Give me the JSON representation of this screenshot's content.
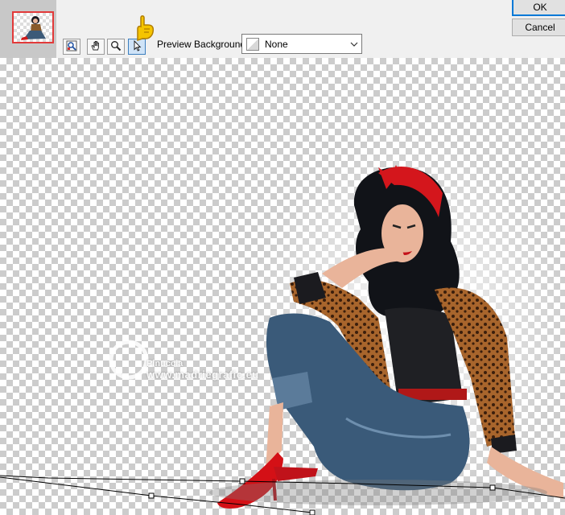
{
  "toolbar": {
    "preview_background_label": "Preview Background:",
    "preview_background_value": "None",
    "tools": [
      "zoom-fit-icon",
      "hand-icon",
      "magnifier-icon",
      "pointer-icon"
    ],
    "ok_label": "OK",
    "cancel_label": "Cancel"
  },
  "canvas": {
    "watermark_line1": "Pinuccia",
    "watermark_line2": "www.madriegrafic.eu"
  },
  "colors": {
    "accent": "#0078d7",
    "thumb_border": "#e23a3a",
    "annotation_hand": "#f5c400"
  }
}
